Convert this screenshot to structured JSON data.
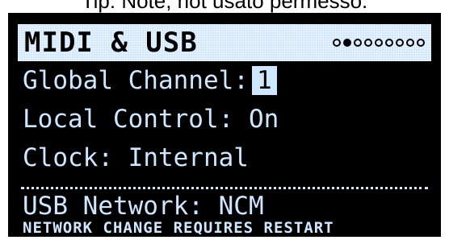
{
  "caption": "Tip: Note, not usato permesso.",
  "screen": {
    "title": "MIDI & USB",
    "page_dots": {
      "total": 9,
      "active_index": 1
    },
    "rows": [
      {
        "label": "Global Channel:",
        "value": "1"
      },
      {
        "label": "Local Control:",
        "value": "On"
      },
      {
        "label": "Clock:",
        "value": "Internal"
      }
    ],
    "usb_label": "USB Network:",
    "usb_value": "NCM",
    "note": "NETWORK CHANGE REQUIRES RESTART"
  },
  "colors": {
    "screen_bg": "#000000",
    "accent": "#cfe6ff"
  }
}
